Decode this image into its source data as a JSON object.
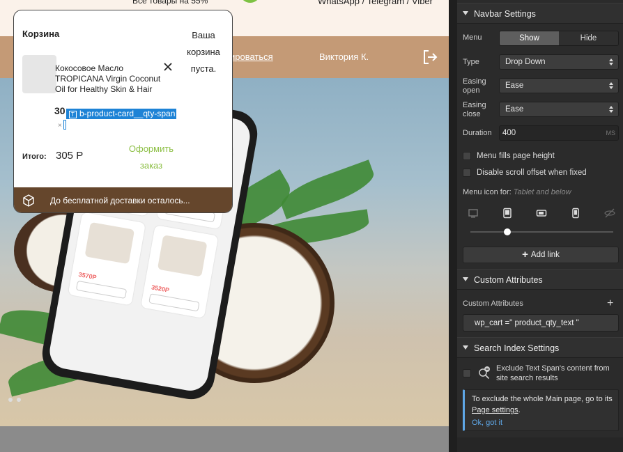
{
  "site": {
    "topbar_left_text": "Все товары на 55%",
    "topbar_right_text": "WhatsApp / Telegram / Viber",
    "nav_link": "ироваться",
    "nav_user": "Виктория К."
  },
  "cart": {
    "title": "Корзина",
    "empty_text": "Ваша корзина пуста.",
    "item_name": "Кокосовое Масло TROPICANA Virgin Coconut Oil for Healthy Skin & Hair",
    "item_price_partial": "30",
    "qty_span_label": "b-product-card__qty-span",
    "qty_times": "×",
    "total_label": "Итого:",
    "total_value": "305 Р",
    "checkout_label": "Оформить заказ",
    "free_shipping_text": "До бесплатной доставки осталось..."
  },
  "panel": {
    "navbar_settings": {
      "title": "Navbar Settings",
      "menu_label": "Menu",
      "menu_show": "Show",
      "menu_hide": "Hide",
      "type_label": "Type",
      "type_value": "Drop Down",
      "easing_open_label": "Easing open",
      "easing_open_value": "Ease",
      "easing_close_label": "Easing close",
      "easing_close_value": "Ease",
      "duration_label": "Duration",
      "duration_value": "400",
      "duration_unit": "MS",
      "fills_height_label": "Menu fills page height",
      "disable_scroll_label": "Disable scroll offset when fixed",
      "menu_icon_label": "Menu icon for:",
      "menu_icon_hint": "Tablet and below",
      "add_link_label": "Add link"
    },
    "custom_attributes": {
      "title": "Custom Attributes",
      "label": "Custom Attributes",
      "attribute_value": "wp_cart =\" product_qty_text \""
    },
    "search_index": {
      "title": "Search Index Settings",
      "exclude_label": "Exclude Text Span's content from site search results",
      "info_text_before": "To exclude the whole Main page, go to its ",
      "info_link": "Page settings",
      "info_text_after": ".",
      "ok_label": "Ok, got it"
    }
  },
  "colors": {
    "navbar_brown": "#c49a76",
    "cart_footer": "#65462c",
    "checkout_green": "#8dbf45",
    "selection_blue": "#1e83d6",
    "panel_bg": "#2b2b2b",
    "info_accent": "#5fa8e8"
  }
}
